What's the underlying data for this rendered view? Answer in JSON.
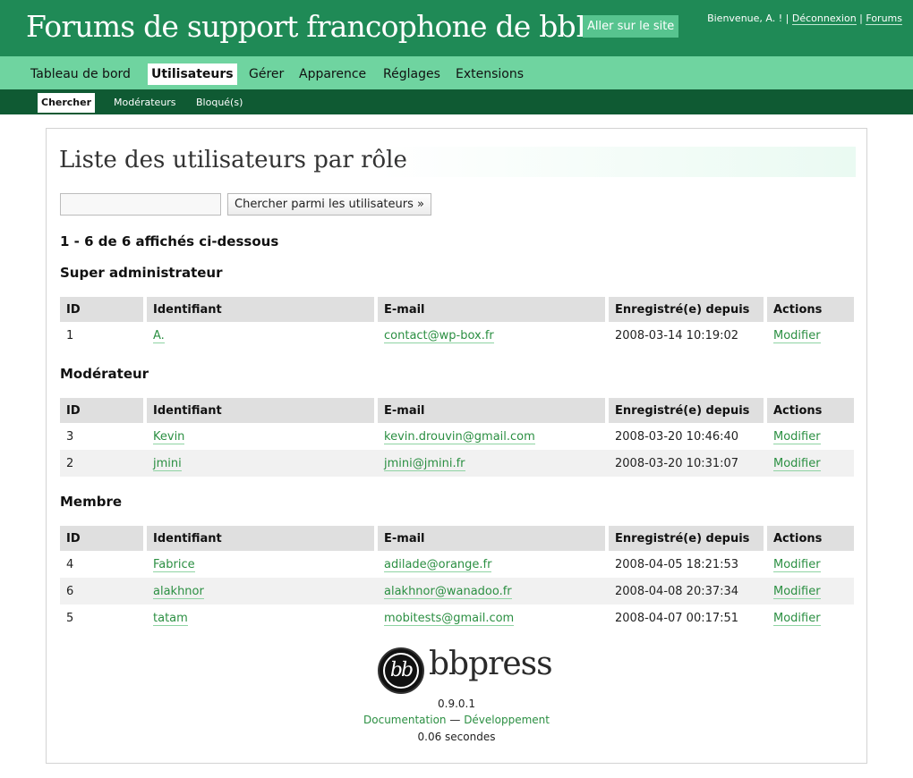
{
  "header": {
    "site_title": "Forums de support francophone de bbPress",
    "visit_site": "Aller sur le site",
    "welcome": "Bienvenue, A. !",
    "logout": "Déconnexion",
    "forums": "Forums",
    "separator": "|"
  },
  "menu": {
    "items": [
      {
        "label": "Tableau de bord"
      },
      {
        "label": "Utilisateurs"
      },
      {
        "label": "Gérer"
      },
      {
        "label": "Apparence"
      },
      {
        "label": "Réglages"
      },
      {
        "label": "Extensions"
      }
    ],
    "active": "Utilisateurs"
  },
  "submenu": {
    "items": [
      {
        "label": "Chercher"
      },
      {
        "label": "Modérateurs"
      },
      {
        "label": "Bloqué(s)"
      }
    ],
    "active": "Chercher"
  },
  "main": {
    "title": "Liste des utilisateurs par rôle",
    "search": {
      "value": "",
      "button": "Chercher parmi les utilisateurs »"
    },
    "count_text": "1 - 6 de 6 affichés ci-dessous",
    "columns": [
      "ID",
      "Identifiant",
      "E-mail",
      "Enregistré(e) depuis",
      "Actions"
    ],
    "roles": [
      {
        "title": "Super administrateur",
        "rows": [
          {
            "id": "1",
            "login": "A.",
            "email": "contact@wp-box.fr",
            "registered": "2008-03-14 10:19:02",
            "action": "Modifier"
          }
        ]
      },
      {
        "title": "Modérateur",
        "rows": [
          {
            "id": "3",
            "login": "Kevin",
            "email": "kevin.drouvin@gmail.com",
            "registered": "2008-03-20 10:46:40",
            "action": "Modifier"
          },
          {
            "id": "2",
            "login": "jmini",
            "email": "jmini@jmini.fr",
            "registered": "2008-03-20 10:31:07",
            "action": "Modifier"
          }
        ]
      },
      {
        "title": "Membre",
        "rows": [
          {
            "id": "4",
            "login": "Fabrice",
            "email": "adilade@orange.fr",
            "registered": "2008-04-05 18:21:53",
            "action": "Modifier"
          },
          {
            "id": "6",
            "login": "alakhnor",
            "email": "alakhnor@wanadoo.fr",
            "registered": "2008-04-08 20:37:34",
            "action": "Modifier"
          },
          {
            "id": "5",
            "login": "tatam",
            "email": "mobitests@gmail.com",
            "registered": "2008-04-07 00:17:51",
            "action": "Modifier"
          }
        ]
      }
    ]
  },
  "footer": {
    "logo_text": "bbpress",
    "logo_badge": "bb",
    "version": "0.9.0.1",
    "documentation": "Documentation",
    "dash": "—",
    "development": "Développement",
    "timing": "0.06 secondes"
  },
  "colors": {
    "header_bg": "#1f8a56",
    "menu_bg": "#6fd4a0",
    "submenu_bg": "#0f5a33",
    "link": "#2b8f42"
  }
}
